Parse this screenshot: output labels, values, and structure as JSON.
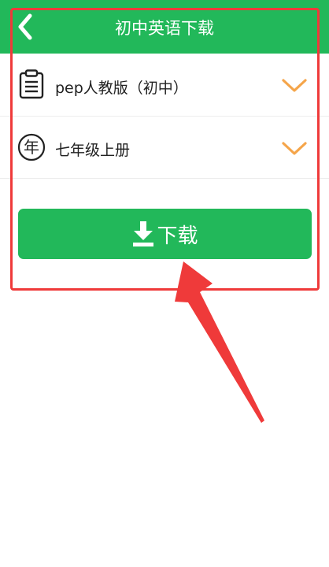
{
  "header": {
    "title": "初中英语下载",
    "back_icon": "chevron-left-icon"
  },
  "selectors": [
    {
      "icon": "clipboard-icon",
      "value": "pep人教版（初中）",
      "expand_icon": "chevron-down-icon"
    },
    {
      "icon": "year-icon",
      "icon_glyph": "年",
      "value": "七年级上册",
      "expand_icon": "chevron-down-icon"
    }
  ],
  "download_button": {
    "label": "下载",
    "icon": "download-icon"
  },
  "annotation": {
    "box_color": "#ef3a3a",
    "arrow_color": "#ef3a3a"
  },
  "colors": {
    "accent": "#22b85a",
    "chevron": "#f5a54a"
  }
}
